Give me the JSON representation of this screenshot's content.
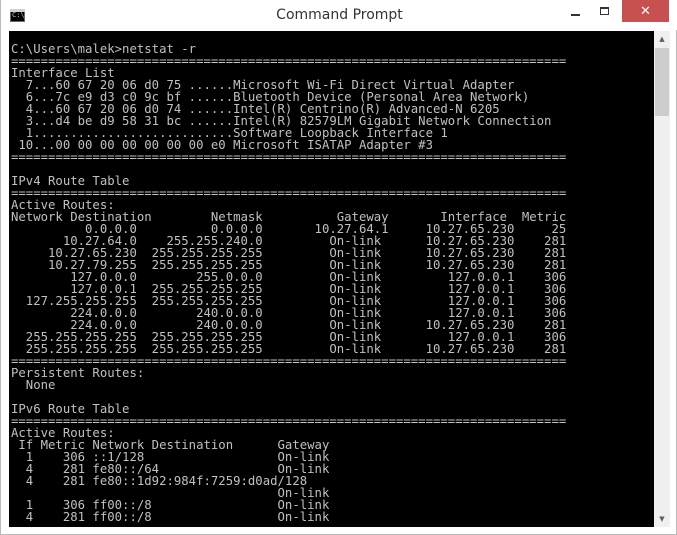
{
  "window": {
    "title": "Command Prompt",
    "icon_label": "C:\\",
    "minimize_icon": "minimize-icon",
    "maximize_icon": "maximize-icon",
    "close_symbol": "✕"
  },
  "console": {
    "lines": [
      "C:\\Users\\malek>netstat -r",
      "===========================================================================",
      "Interface List",
      "  7...60 67 20 06 d0 75 ......Microsoft Wi-Fi Direct Virtual Adapter",
      "  6...7c e9 d3 c0 9c bf ......Bluetooth Device (Personal Area Network)",
      "  4...60 67 20 06 d0 74 ......Intel(R) Centrino(R) Advanced-N 6205",
      "  3...d4 be d9 58 31 bc ......Intel(R) 82579LM Gigabit Network Connection",
      "  1...........................Software Loopback Interface 1",
      " 10...00 00 00 00 00 00 00 e0 Microsoft ISATAP Adapter #3",
      "===========================================================================",
      "",
      "IPv4 Route Table",
      "===========================================================================",
      "Active Routes:",
      "Network Destination        Netmask          Gateway       Interface  Metric",
      "          0.0.0.0          0.0.0.0       10.27.64.1     10.27.65.230     25",
      "       10.27.64.0    255.255.240.0         On-link      10.27.65.230    281",
      "     10.27.65.230  255.255.255.255         On-link      10.27.65.230    281",
      "     10.27.79.255  255.255.255.255         On-link      10.27.65.230    281",
      "        127.0.0.0        255.0.0.0         On-link         127.0.0.1    306",
      "        127.0.0.1  255.255.255.255         On-link         127.0.0.1    306",
      "  127.255.255.255  255.255.255.255         On-link         127.0.0.1    306",
      "        224.0.0.0        240.0.0.0         On-link         127.0.0.1    306",
      "        224.0.0.0        240.0.0.0         On-link      10.27.65.230    281",
      "  255.255.255.255  255.255.255.255         On-link         127.0.0.1    306",
      "  255.255.255.255  255.255.255.255         On-link      10.27.65.230    281",
      "===========================================================================",
      "Persistent Routes:",
      "  None",
      "",
      "IPv6 Route Table",
      "===========================================================================",
      "Active Routes:",
      " If Metric Network Destination      Gateway",
      "  1    306 ::1/128                  On-link",
      "  4    281 fe80::/64                On-link",
      "  4    281 fe80::1d92:984f:7259:d0ad/128",
      "                                    On-link",
      "  1    306 ff00::/8                 On-link",
      "  4    281 ff00::/8                 On-link"
    ]
  },
  "scrollbar": {
    "up_arrow": "▲",
    "down_arrow": "▼"
  }
}
